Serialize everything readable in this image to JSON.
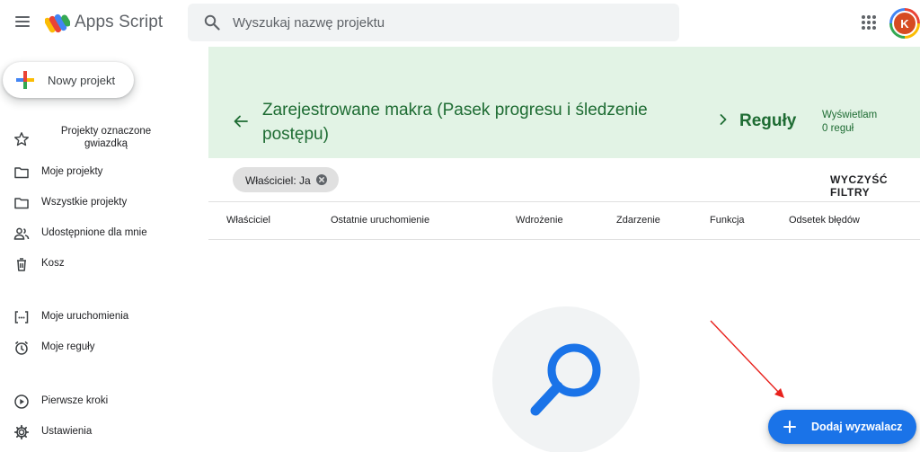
{
  "header": {
    "app_title": "Apps Script",
    "search_placeholder": "Wyszukaj nazwę projektu",
    "avatar_letter": "K",
    "icons": [
      "menu-icon",
      "apps-script-logo",
      "search-icon",
      "apps-grid-icon"
    ]
  },
  "sidebar": {
    "new_project_label": "Nowy projekt",
    "items": [
      {
        "label": "Projekty oznaczone gwiazdką",
        "icon": "star-icon"
      },
      {
        "label": "Moje projekty",
        "icon": "folder-icon"
      },
      {
        "label": "Wszystkie projekty",
        "icon": "folder-icon"
      },
      {
        "label": "Udostępnione dla mnie",
        "icon": "people-icon"
      },
      {
        "label": "Kosz",
        "icon": "trash-icon"
      },
      {
        "label": "Moje uruchomienia",
        "icon": "executions-icon"
      },
      {
        "label": "Moje reguły",
        "icon": "alarm-icon"
      },
      {
        "label": "Pierwsze kroki",
        "icon": "play-circle-icon"
      },
      {
        "label": "Ustawienia",
        "icon": "gear-icon"
      }
    ]
  },
  "banner": {
    "project_title": "Zarejestrowane makra (Pasek progresu i śledzenie postępu)",
    "section_title": "Reguły",
    "showing_line1": "Wyświetlam",
    "showing_line2": "0 reguł"
  },
  "filters": {
    "chip_label": "Właściciel: Ja",
    "clear_label": "WYCZYŚĆ FILTRY"
  },
  "table": {
    "columns": [
      "Właściciel",
      "Ostatnie uruchomienie",
      "Wdrożenie",
      "Zdarzenie",
      "Funkcja",
      "Odsetek błędów"
    ]
  },
  "fab": {
    "label": "Dodaj wyzwalacz"
  },
  "colors": {
    "banner_bg": "#e2f3e5",
    "banner_text": "#1e6c33",
    "fab_bg": "#1a73e8",
    "magnifier": "#1a73e8",
    "annotation_arrow": "#e8211c",
    "avatar_bg": "#d64b22"
  }
}
